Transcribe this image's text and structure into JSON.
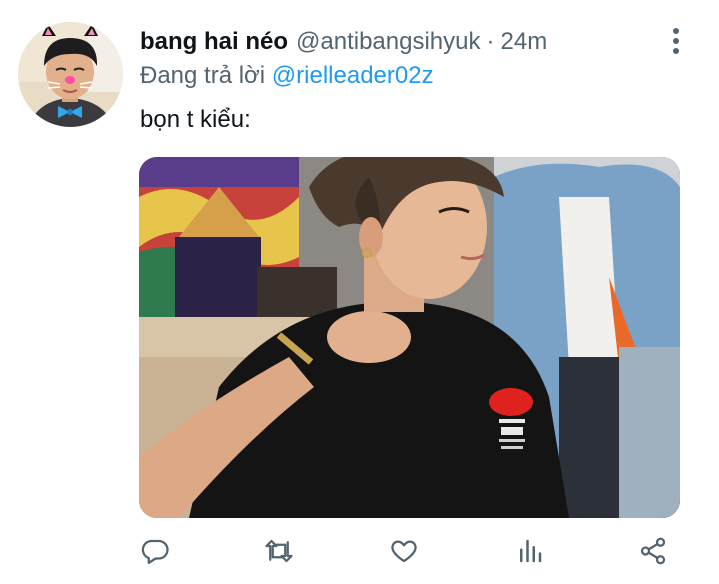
{
  "tweet": {
    "display_name": "bang hai néo",
    "handle": "@antibangsihyuk",
    "separator": "·",
    "time": "24m",
    "reply_prefix": "Đang trả lời ",
    "reply_to": "@rielleader02z",
    "text": "bọn t kiểu:"
  },
  "icons": {
    "more": "more-vertical-icon",
    "reply": "reply-bubble-icon",
    "retweet": "retweet-icon",
    "like": "heart-icon",
    "analytics": "analytics-bars-icon",
    "share": "share-nodes-icon"
  },
  "colors": {
    "text_primary": "#0f1419",
    "text_secondary": "#536471",
    "accent": "#1d9bf0"
  }
}
